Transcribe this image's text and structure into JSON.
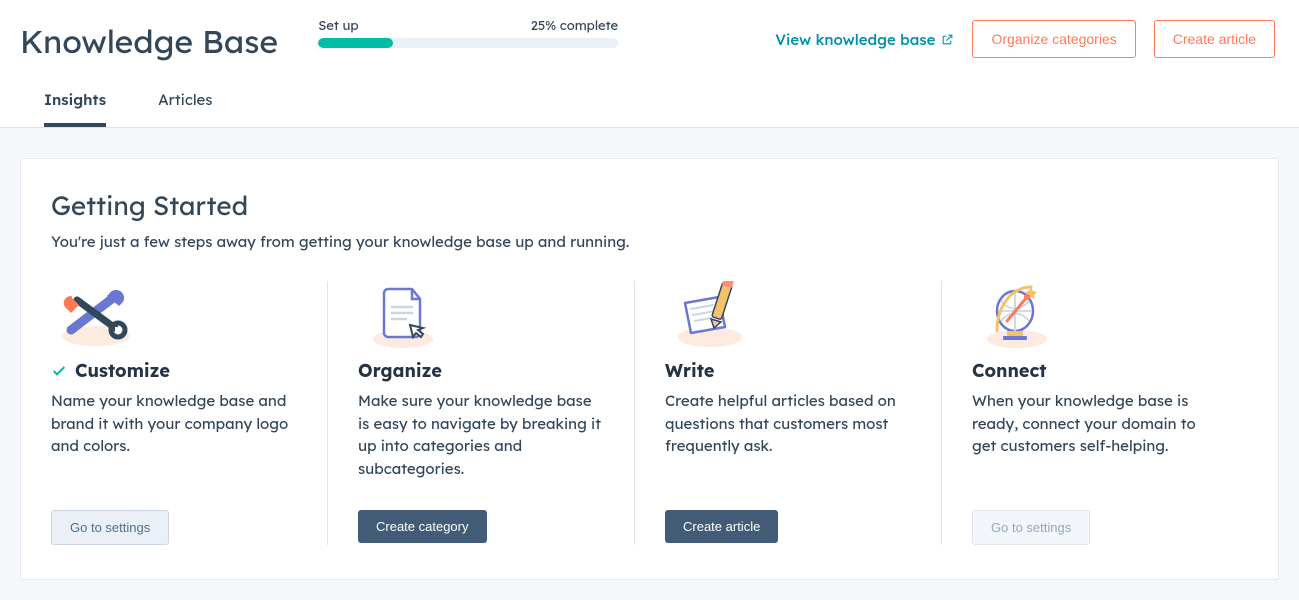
{
  "header": {
    "title": "Knowledge Base",
    "progress_label": "Set up",
    "progress_text": "25% complete",
    "progress_percent": 25,
    "view_link": "View knowledge base",
    "organize_btn": "Organize categories",
    "create_btn": "Create article"
  },
  "tabs": {
    "insights": "Insights",
    "articles": "Articles",
    "active": "insights"
  },
  "getting_started": {
    "title": "Getting Started",
    "subtitle": "You're just a few steps away from getting your knowledge base up and running."
  },
  "cards": [
    {
      "key": "customize",
      "icon": "brush-wrench-icon",
      "done": true,
      "title": "Customize",
      "desc": "Name your knowledge base and brand it with your company logo and colors.",
      "button_label": "Go to settings",
      "button_style": "secondary"
    },
    {
      "key": "organize",
      "icon": "document-cursor-icon",
      "done": false,
      "title": "Organize",
      "desc": "Make sure your knowledge base is easy to navigate by breaking it up into categories and subcategories.",
      "button_label": "Create category",
      "button_style": "primary"
    },
    {
      "key": "write",
      "icon": "pencil-paper-icon",
      "done": false,
      "title": "Write",
      "desc": "Create helpful articles based on questions that customers most frequently ask.",
      "button_label": "Create article",
      "button_style": "primary"
    },
    {
      "key": "connect",
      "icon": "globe-icon",
      "done": false,
      "title": "Connect",
      "desc": "When your knowledge base is ready, connect your domain to get customers self-helping.",
      "button_label": "Go to settings",
      "button_style": "secondary-disabled"
    }
  ]
}
